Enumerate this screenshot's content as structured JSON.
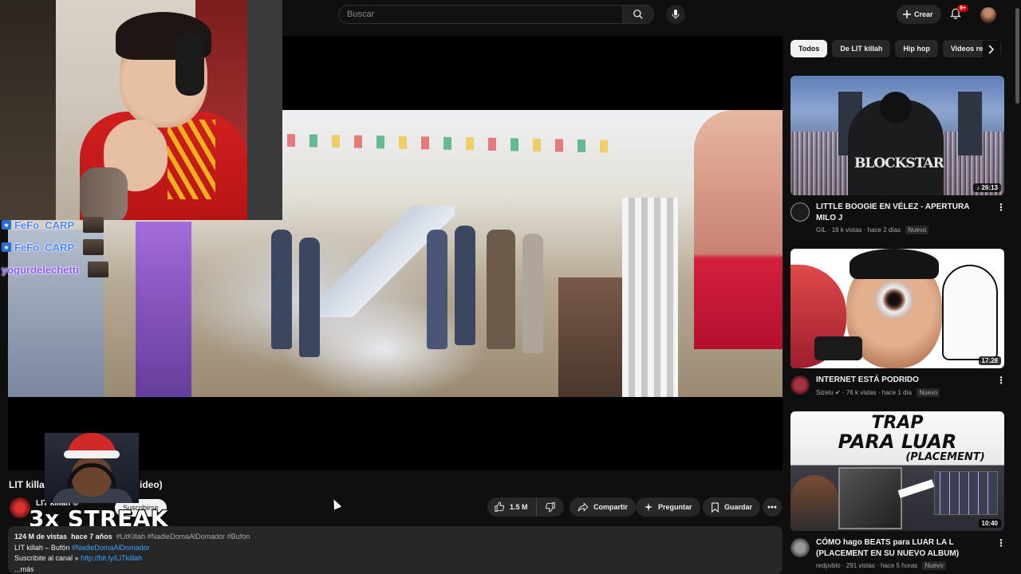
{
  "topbar": {
    "search_placeholder": "Buscar",
    "create_label": "Crear",
    "notifications_count": "9+"
  },
  "chat": [
    {
      "name": "FeFo_CARP",
      "sep": "·"
    },
    {
      "name": "FeFo_CARP",
      "sep": "·"
    },
    {
      "name": "yogurdelechetti",
      "sep": "·"
    }
  ],
  "video": {
    "title_start": "LIT killa",
    "title_end": "ideo)",
    "channel_name": "LIT killah ©",
    "subscribe_label": "Suscribirse",
    "likes": "1.5 M",
    "share_label": "Compartir",
    "ask_label": "Preguntar",
    "save_label": "Guardar"
  },
  "streak": {
    "text": "3x STREAK"
  },
  "description": {
    "views": "124 M de vistas",
    "age": "hace 7 años",
    "tags": "#LitKillah #NadieDomaAlDomador #Bufon",
    "line2_text": "LIT killah – Bufón",
    "line2_tag": "#NadieDomaAlDomador",
    "line3_text": "Suscribite al canal »",
    "line3_link": "http://bit.ly/LITkillah",
    "more_label": "...más"
  },
  "chips": [
    "Todos",
    "De LIT killah",
    "Hip hop",
    "Videos relac"
  ],
  "recommendations": [
    {
      "title": "LITTLE BOOGIE EN VÉLEZ - APERTURA MILO J",
      "channel": "GIL",
      "views": "18 k vistas",
      "age": "hace 2 días",
      "badge": "Nuevo",
      "duration": "♪ 26:13",
      "thumb_text": "BLOCKSTAR"
    },
    {
      "title": "INTERNET ESTÁ PODRIDO",
      "channel": "Sizelu",
      "views": "76 k vistas",
      "age": "hace 1 día",
      "badge": "Nuevo",
      "duration": "17:28"
    },
    {
      "title": "CÓMO hago BEATS para LUAR LA L (PLACEMENT EN SU NUEVO ALBUM)",
      "channel": "redpvblo",
      "views": "291 vistas",
      "age": "hace 5 horas",
      "badge": "Nuevo",
      "duration": "10:40",
      "thumb_line1": "TRAP",
      "thumb_line2": "PARA LUAR",
      "thumb_line3": "(PLACEMENT)"
    }
  ],
  "colors": {
    "background": "#0f0f0f",
    "surface": "#272727",
    "link": "#3ea6ff",
    "chat_name": "#4a86ff"
  }
}
